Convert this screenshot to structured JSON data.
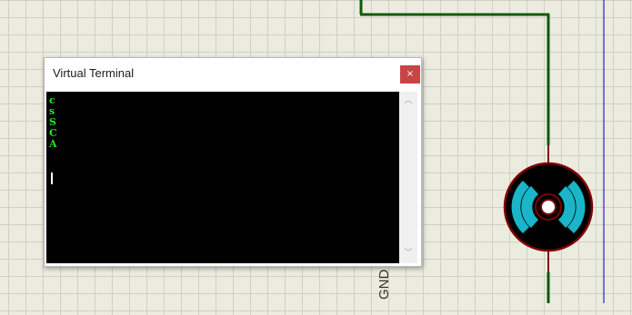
{
  "window": {
    "title": "Virtual Terminal",
    "close_glyph": "×"
  },
  "terminal": {
    "lines": [
      "c",
      "s",
      "S",
      "C",
      "A"
    ],
    "text_color": "#22e622",
    "background": "#000000"
  },
  "scrollbar": {
    "up_glyph": "︿",
    "down_glyph": "﹀"
  },
  "schematic": {
    "ground_label": "GND",
    "wire_color": "#0c5a0c",
    "component_outline": "#800000",
    "rotor_color": "#1ab5c8",
    "sheet_border_color": "#3434c6"
  },
  "icons": [
    "close-icon",
    "scroll-up-icon",
    "scroll-down-icon",
    "motor-icon"
  ]
}
